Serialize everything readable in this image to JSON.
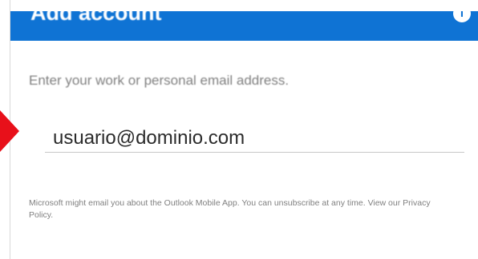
{
  "header": {
    "title": "Add account",
    "info_icon": "info-icon",
    "color": "#0f73d4"
  },
  "form": {
    "instruction": "Enter your work or personal email address.",
    "email_value": "usuario@dominio.com"
  },
  "disclaimer": {
    "text": "Microsoft might email you about the Outlook Mobile App. You can unsubscribe at any time. View our ",
    "link_text": "Privacy Policy",
    "suffix": "."
  },
  "annotation": {
    "arrow_color": "#e8101a"
  }
}
